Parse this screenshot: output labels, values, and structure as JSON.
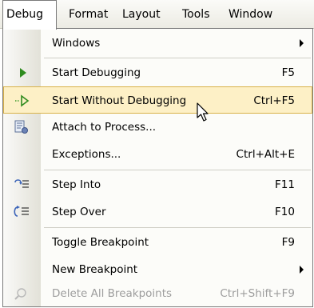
{
  "menubar": {
    "items": [
      {
        "label": "Debug"
      },
      {
        "label": "Format"
      },
      {
        "label": "Layout"
      },
      {
        "label": "Tools"
      },
      {
        "label": "Window"
      }
    ]
  },
  "debug_menu": {
    "items": [
      {
        "label": "Windows",
        "shortcut": "",
        "submenu": true
      },
      {
        "label": "Start Debugging",
        "shortcut": "F5",
        "icon": "play-icon"
      },
      {
        "label": "Start Without Debugging",
        "shortcut": "Ctrl+F5",
        "icon": "play-outline-icon",
        "highlighted": true
      },
      {
        "label": "Attach to Process...",
        "shortcut": "",
        "icon": "attach-process-icon"
      },
      {
        "label": "Exceptions...",
        "shortcut": "Ctrl+Alt+E"
      },
      {
        "label": "Step Into",
        "shortcut": "F11",
        "icon": "step-into-icon"
      },
      {
        "label": "Step Over",
        "shortcut": "F10",
        "icon": "step-over-icon"
      },
      {
        "label": "Toggle Breakpoint",
        "shortcut": "F9"
      },
      {
        "label": "New Breakpoint",
        "shortcut": "",
        "submenu": true
      },
      {
        "label": "Delete All Breakpoints",
        "shortcut": "Ctrl+Shift+F9",
        "icon": "delete-breakpoints-icon",
        "disabled": true
      }
    ]
  },
  "colors": {
    "highlight_bg": "#fdf0c6",
    "highlight_border": "#d8b24a",
    "play_green": "#2e8b1e",
    "disabled_text": "#9d9d9d"
  }
}
